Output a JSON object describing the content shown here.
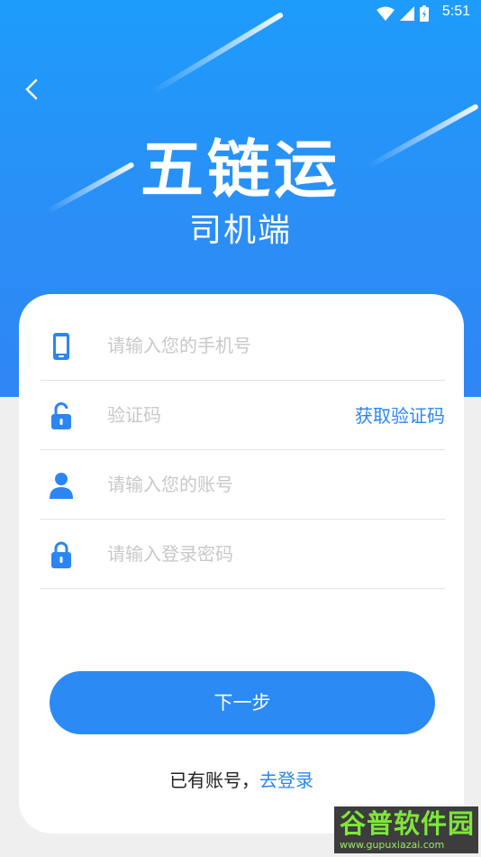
{
  "status_bar": {
    "time": "5:51",
    "wifi_icon": "wifi-icon",
    "signal_icon": "signal-icon",
    "battery_icon": "battery-icon"
  },
  "header": {
    "back_icon": "chevron-left-icon",
    "app_name": "五链运",
    "role": "司机端"
  },
  "form": {
    "phone": {
      "icon": "phone-icon",
      "placeholder": "请输入您的手机号",
      "value": ""
    },
    "code": {
      "icon": "unlock-icon",
      "placeholder": "验证码",
      "value": "",
      "get_code_label": "获取验证码"
    },
    "account": {
      "icon": "user-icon",
      "placeholder": "请输入您的账号",
      "value": ""
    },
    "password": {
      "icon": "lock-icon",
      "placeholder": "请输入登录密码",
      "value": ""
    }
  },
  "next_button": {
    "label": "下一步"
  },
  "login_prompt": {
    "text": "已有账号，",
    "link": "去登录"
  },
  "watermark": {
    "title": "谷普软件园",
    "url": "www.gupuxiazai.com"
  },
  "colors": {
    "primary": "#2b8af4",
    "hero_top": "#1e9cfb",
    "background": "#efefef"
  }
}
